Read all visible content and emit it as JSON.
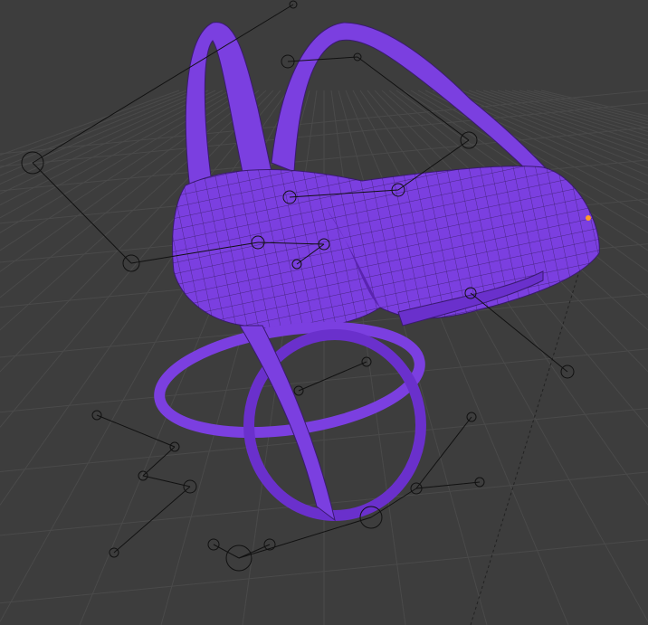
{
  "viewport": {
    "background_color": "#3d3d3d",
    "grid_color": "#4a4a4a",
    "mesh_color": "#7b3fe0",
    "mesh_dark_color": "#5a24b0",
    "wire_color": "#1c1030",
    "bone_color": "#111111",
    "selected_vertex_color": "#ff9a2a"
  }
}
